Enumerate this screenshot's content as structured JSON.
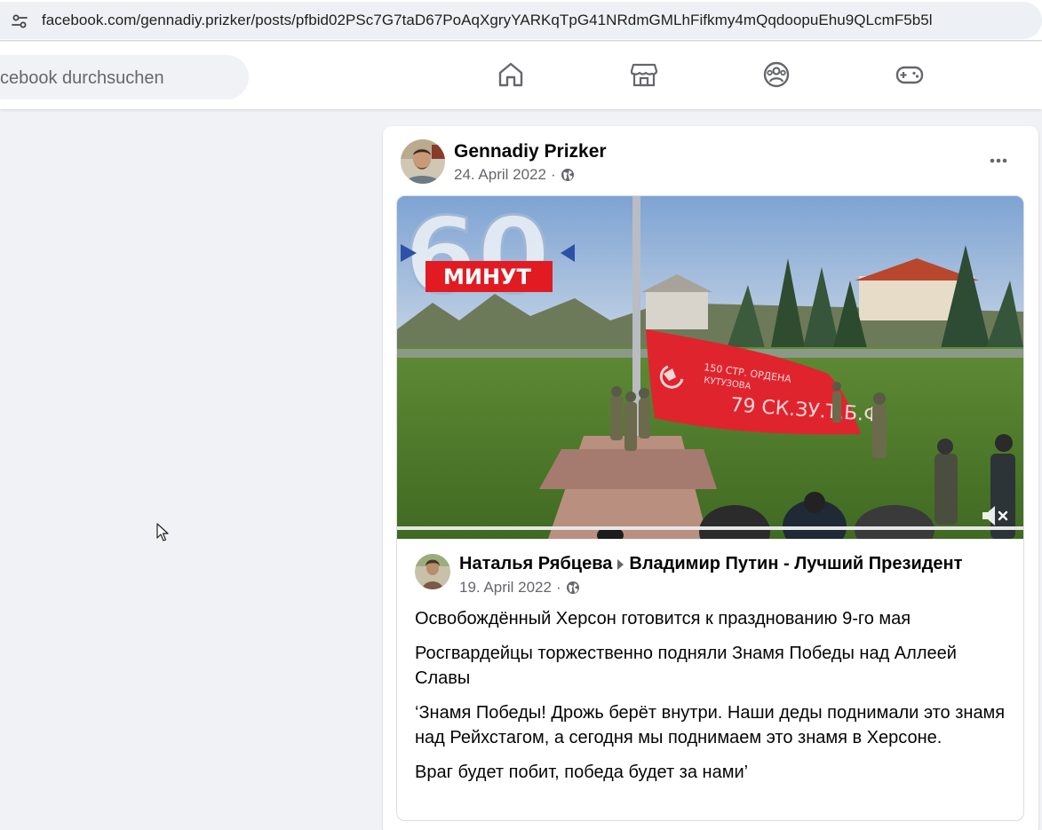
{
  "browser": {
    "url": "facebook.com/gennadiy.prizker/posts/pfbid02PSc7G7taD67PoAqXgryYARKqTpG41NRdmGMLhFifkmy4mQqdoopuEhu9QLcmF5b5l",
    "site_info_icon": "tune-icon"
  },
  "header": {
    "search_placeholder": "cebook durchsuchen",
    "nav": [
      "home-icon",
      "marketplace-icon",
      "groups-icon",
      "gaming-icon"
    ]
  },
  "post": {
    "author": "Gennadiy Prizker",
    "date": "24. April 2022",
    "separator": "·",
    "audience_icon": "globe-icon",
    "shared": {
      "video_overlay_number": "60",
      "video_overlay_label": "МИНУТ",
      "flag_text_1": "150 СТР. ОРДЕНА",
      "flag_text_2": "КУТУЗОВА",
      "flag_text_3": "79 СК.ЗУ.Т.Б.Ф.",
      "author": "Наталья Рябцева",
      "target": "Владимир Путин - Лучший Президент",
      "date": "19. April 2022",
      "separator": "·",
      "paragraphs": [
        "Освобождённый Херсон готовится к празднованию 9-го мая",
        "Росгвардейцы торжественно подняли Знамя Победы над Аллеей Славы",
        "‘Знамя Победы! Дрожь берёт внутри. Наши деды поднимали это знамя над Рейхстагом, а сегодня мы поднимаем это знамя в Херсоне.",
        "Враг будет побит, победа будет за нами’"
      ]
    }
  },
  "colors": {
    "background": "#f0f2f5",
    "card": "#ffffff",
    "secondary_text": "#65676b",
    "flag_red": "#e0242e"
  }
}
